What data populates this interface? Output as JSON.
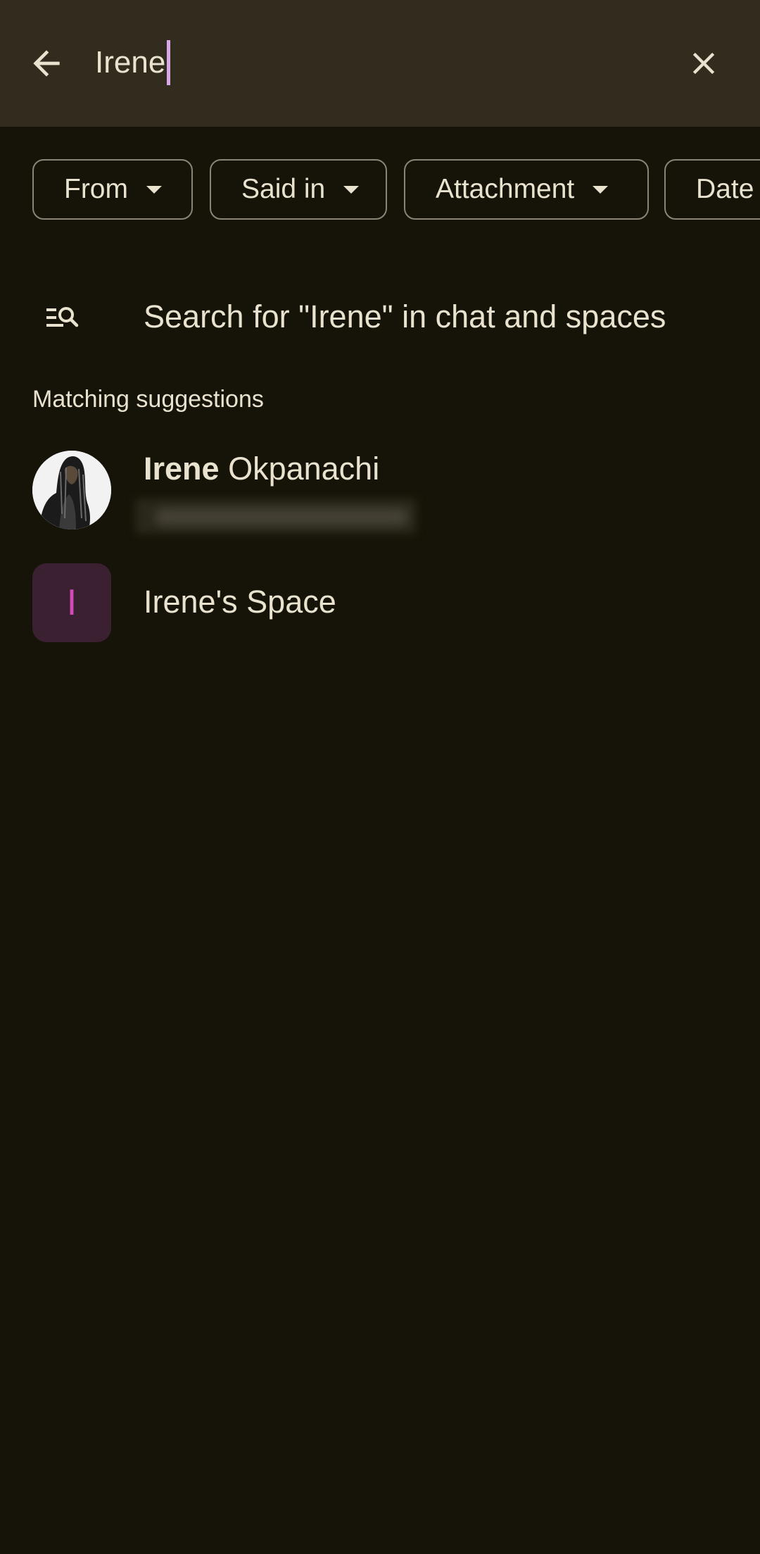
{
  "search": {
    "query": "Irene"
  },
  "icons": {
    "back": "arrow-back-icon",
    "clear": "close-icon",
    "search_all": "manage-search-icon",
    "chip_arrow": "dropdown-arrow-icon"
  },
  "chips": [
    {
      "label": "From"
    },
    {
      "label": "Said in"
    },
    {
      "label": "Attachment"
    },
    {
      "label": "Date"
    }
  ],
  "search_all": {
    "label": "Search for \"Irene\" in chat and spaces"
  },
  "suggestions": {
    "title": "Matching suggestions",
    "items": [
      {
        "name_match": "Irene",
        "name_rest": " Okpanachi",
        "type": "person"
      },
      {
        "name": "Irene's Space",
        "initial": "I",
        "type": "space"
      }
    ]
  },
  "colors": {
    "background": "#161408",
    "top_bar": "#312c1d",
    "text": "#e8e2cf",
    "caret": "#d9a6e8",
    "chip_border": "#8a8576",
    "space_avatar_bg": "#3a2030",
    "space_initial": "#d24ab8"
  }
}
